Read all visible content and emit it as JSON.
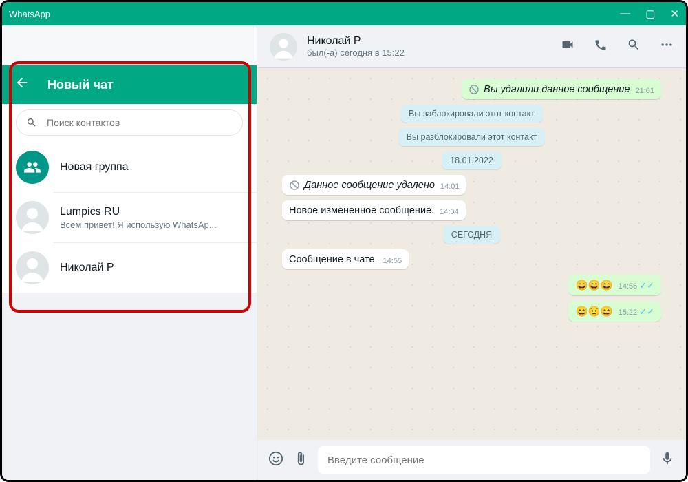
{
  "titlebar": {
    "app": "WhatsApp"
  },
  "panel": {
    "title": "Новый чат",
    "search_placeholder": "Поиск контактов",
    "new_group": "Новая группа",
    "contacts": [
      {
        "name": "Lumpics RU",
        "status": "Всем привет! Я использую WhatsAp..."
      },
      {
        "name": "Николай Р",
        "status": ""
      }
    ]
  },
  "chat": {
    "name": "Николай Р",
    "status": "был(-а) сегодня в 15:22",
    "input_placeholder": "Введите сообщение",
    "messages": [
      {
        "kind": "out-deleted",
        "text": "Вы удалили данное сообщение",
        "time": "21:01"
      },
      {
        "kind": "sys",
        "text": "Вы заблокировали этот контакт"
      },
      {
        "kind": "sys",
        "text": "Вы разблокировали этот контакт"
      },
      {
        "kind": "sys",
        "text": "18.01.2022"
      },
      {
        "kind": "in-deleted",
        "text": "Данное сообщение удалено",
        "time": "14:01"
      },
      {
        "kind": "in",
        "text": "Новое измененное сообщение.",
        "time": "14:04"
      },
      {
        "kind": "sys",
        "text": "СЕГОДНЯ"
      },
      {
        "kind": "in",
        "text": "Сообщение в чате.",
        "time": "14:55"
      },
      {
        "kind": "out",
        "text": "😄😄😄",
        "time": "14:56",
        "read": true,
        "emoji": true
      },
      {
        "kind": "out",
        "text": "😄😟😄",
        "time": "15:22",
        "read": true,
        "emoji": true
      }
    ]
  }
}
